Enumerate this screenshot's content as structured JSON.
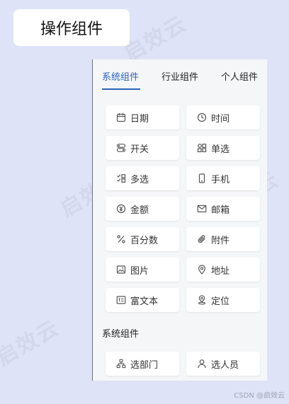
{
  "header": {
    "title": "操作组件"
  },
  "tabs": [
    {
      "label": "系统组件",
      "active": true
    },
    {
      "label": "行业组件",
      "active": false
    },
    {
      "label": "个人组件",
      "active": false
    }
  ],
  "system_items": [
    {
      "label": "日期",
      "icon": "calendar-icon"
    },
    {
      "label": "时间",
      "icon": "clock-icon"
    },
    {
      "label": "开关",
      "icon": "switch-icon"
    },
    {
      "label": "单选",
      "icon": "radio-icon"
    },
    {
      "label": "多选",
      "icon": "checkbox-icon"
    },
    {
      "label": "手机",
      "icon": "phone-icon"
    },
    {
      "label": "金额",
      "icon": "yen-icon"
    },
    {
      "label": "邮箱",
      "icon": "mail-icon"
    },
    {
      "label": "百分数",
      "icon": "percent-icon"
    },
    {
      "label": "附件",
      "icon": "paperclip-icon"
    },
    {
      "label": "图片",
      "icon": "image-icon"
    },
    {
      "label": "地址",
      "icon": "location-icon"
    },
    {
      "label": "富文本",
      "icon": "rich-text-icon"
    },
    {
      "label": "定位",
      "icon": "pin-icon"
    }
  ],
  "section2": {
    "title": "系统组件",
    "items": [
      {
        "label": "选部门",
        "icon": "department-icon"
      },
      {
        "label": "选人员",
        "icon": "person-icon"
      }
    ]
  },
  "watermark": {
    "text": "启效云"
  },
  "credit": "CSDN @启效云",
  "colors": {
    "accent": "#2c63b8",
    "background": "#dfe3f7",
    "panel": "#f5f6f8"
  }
}
